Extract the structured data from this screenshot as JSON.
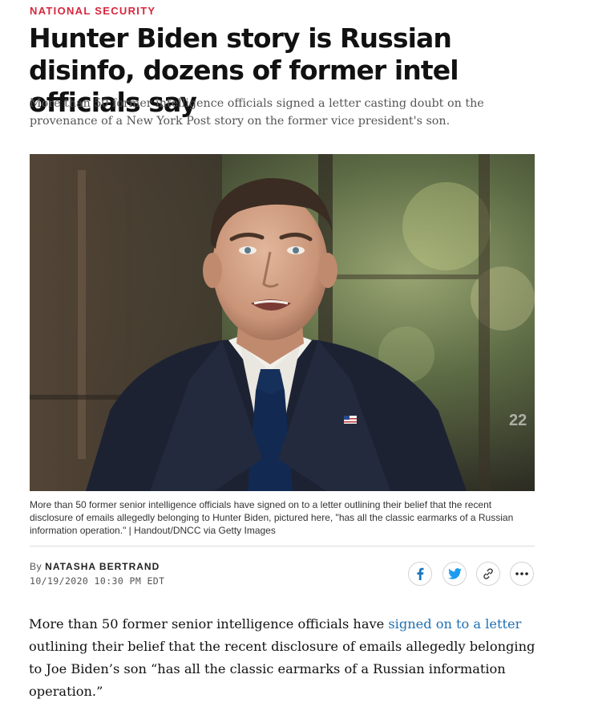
{
  "article": {
    "section": "NATIONAL SECURITY",
    "headline": "Hunter Biden story is Russian disinfo, dozens of former intel officials say",
    "dek": "More than 50 former intelligence officials signed a letter casting doubt on the provenance of a New York Post story on the former vice president's son.",
    "photo": {
      "caption": "More than 50 former senior intelligence officials have signed on to a letter outlining their belief that the recent disclosure of emails allegedly belonging to Hunter Biden, pictured here, \"has all the classic earmarks of a Russian information operation.\" | Handout/DNCC via Getty Images",
      "subject": "man-in-suit-photo",
      "watermark": "22"
    },
    "byline": {
      "prefix": "By",
      "author": "NATASHA BERTRAND",
      "date": "10/19/2020 10:30 PM EDT"
    },
    "share": {
      "icons": [
        "facebook-icon",
        "twitter-icon",
        "link-icon",
        "more-icon"
      ],
      "facebook_color": "#1877c0",
      "twitter_color": "#1d9bf0"
    },
    "body": {
      "before_link": "More than 50 former senior intelligence officials have ",
      "link_text": "signed on to a letter",
      "after_link": " outlining their belief that the recent disclosure of emails allegedly belonging to Joe Biden’s son “has all the classic earmarks of a Russian information operation.”"
    },
    "colors": {
      "section": "#d7263d",
      "link": "#1f6fb2"
    }
  }
}
